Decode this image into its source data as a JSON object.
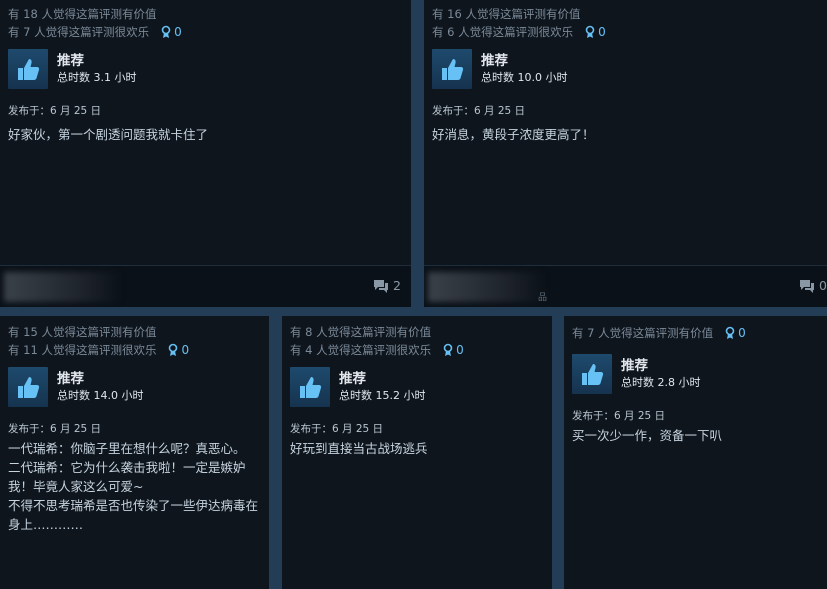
{
  "reviews": [
    {
      "helpful": "有 18 人觉得这篇评测有价值",
      "funny": "有 7 人觉得这篇评测很欢乐",
      "awards": "0",
      "recommendation": "推荐",
      "hours": "总时数 3.1 小时",
      "posted": "发布于：6 月 25 日",
      "body": "好家伙，第一个剧透问题我就卡住了",
      "comments": "2",
      "footer_tag": ""
    },
    {
      "helpful": "有 16 人觉得这篇评测有价值",
      "funny": "有 6 人觉得这篇评测很欢乐",
      "awards": "0",
      "recommendation": "推荐",
      "hours": "总时数 10.0 小时",
      "posted": "发布于：6 月 25 日",
      "body": "好消息，黄段子浓度更高了！",
      "comments": "0",
      "footer_tag": "品"
    },
    {
      "helpful": "有 15 人觉得这篇评测有价值",
      "funny": "有 11 人觉得这篇评测很欢乐",
      "awards": "0",
      "recommendation": "推荐",
      "hours": "总时数 14.0 小时",
      "posted": "发布于：6 月 25 日",
      "body_lines": [
        "一代瑞希：你脑子里在想什么呢？真恶心。",
        "二代瑞希：它为什么袭击我啦！一定是嫉妒",
        "我！毕竟人家这么可爱~",
        "不得不思考瑞希是否也传染了一些伊达病毒在",
        "身上…………"
      ]
    },
    {
      "helpful": "有 8 人觉得这篇评测有价值",
      "funny": "有 4 人觉得这篇评测很欢乐",
      "awards": "0",
      "recommendation": "推荐",
      "hours": "总时数 15.2 小时",
      "posted": "发布于：6 月 25 日",
      "body": "好玩到直接当古战场逃兵"
    },
    {
      "helpful": "有 7 人觉得这篇评测有价值",
      "awards": "0",
      "recommendation": "推荐",
      "hours": "总时数 2.8 小时",
      "posted": "发布于：6 月 25 日",
      "body": "买一次少一作，资备一下叭"
    }
  ],
  "colors": {
    "background": "#233d57",
    "card": "#0f151d",
    "accent": "#66c0f4"
  },
  "icons": {
    "thumb": "thumbs-up-icon",
    "award": "award-icon",
    "comment": "comment-icon"
  }
}
